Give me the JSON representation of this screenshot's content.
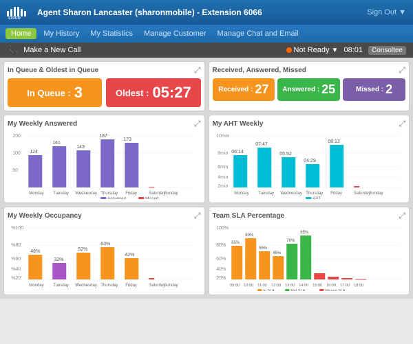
{
  "header": {
    "title": "Agent Sharon Lancaster (sharonmobile) - Extension 6066",
    "sign_out": "Sign Out ▼",
    "logo_text": "cisco"
  },
  "navbar": {
    "items": [
      "Home",
      "My History",
      "My Statistics",
      "Manage Customer",
      "Manage Chat and Email"
    ],
    "active": "Home"
  },
  "statusbar": {
    "make_call": "Make a New Call",
    "status": "Not Ready",
    "time": "08:01",
    "consult": "Consoltee"
  },
  "queue_card": {
    "title": "In Queue & Oldest in Queue",
    "in_queue_label": "In Queue :",
    "in_queue_value": "3",
    "oldest_label": "Oldest :",
    "oldest_value": "05:27"
  },
  "received_card": {
    "title": "Received, Answered, Missed",
    "received_label": "Received :",
    "received_value": "27",
    "answered_label": "Answered :",
    "answered_value": "25",
    "missed_label": "Missed :",
    "missed_value": "2"
  },
  "weekly_answered": {
    "title": "My Weekly Answered",
    "y_max": "200",
    "days": [
      "Monday",
      "Tuesday",
      "Wednesday",
      "Thursday",
      "Friday",
      "Saturday",
      "Sunday"
    ],
    "values": [
      124,
      161,
      143,
      187,
      173,
      2,
      0
    ],
    "color": "#7b68c8"
  },
  "aht_weekly": {
    "title": "My AHT Weekly",
    "y_label": "10min",
    "days": [
      "Monday",
      "Tuesday",
      "Wednesday",
      "Thursday",
      "Friday",
      "Saturday",
      "Sunday"
    ],
    "values": [
      "06:14",
      "07:47",
      "05:52",
      "04:29",
      "08:13",
      "00:10",
      ""
    ],
    "color": "#00bcd4"
  },
  "occupancy": {
    "title": "My Weekly Occupancy",
    "y_label": "%100",
    "days": [
      "Monday",
      "Tuesday",
      "Wednesday",
      "Thursday",
      "Friday",
      "Saturday",
      "Sunday"
    ],
    "values": [
      48,
      32,
      52,
      63,
      42,
      2,
      0
    ],
    "colors": [
      "#f7941d",
      "#a855c8",
      "#f7941d",
      "#f7941d",
      "#f7941d",
      "#e84545",
      "#e84545"
    ]
  },
  "sla": {
    "title": "Team SLA Percentage",
    "y_label": "100%",
    "times": [
      "09:00",
      "10:00",
      "11:00",
      "12:00",
      "13:00",
      "14:00",
      "15:00",
      "16:00",
      "17:00",
      "18:00"
    ],
    "values": [
      65,
      80,
      55,
      45,
      70,
      85,
      12,
      5,
      3,
      2
    ],
    "colors": [
      "#f7941d",
      "#f7941d",
      "#f7941d",
      "#f7941d",
      "#39b54a",
      "#39b54a",
      "#e84545",
      "#e84545",
      "#e84545",
      "#e84545"
    ]
  }
}
